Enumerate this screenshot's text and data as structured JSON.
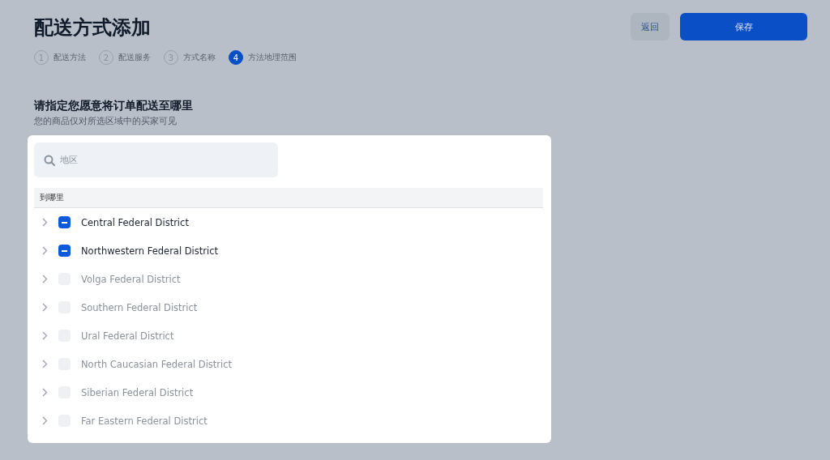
{
  "title": "配送方式添加",
  "steps": [
    {
      "number": "1",
      "label": "配送方法",
      "selected": false
    },
    {
      "number": "2",
      "label": "配送服务",
      "selected": false
    },
    {
      "number": "3",
      "label": "方式名称",
      "selected": false
    },
    {
      "number": "4",
      "label": "方法地理范围",
      "selected": true
    }
  ],
  "buttons": {
    "back": "返回",
    "save": "保存"
  },
  "section": {
    "heading": "请指定您愿意将订单配送至哪里",
    "subtitle": "您的商品仅对所选区域中的买家可见"
  },
  "search": {
    "placeholder": "地区"
  },
  "table": {
    "column": "到哪里",
    "rows": [
      {
        "name": "Central Federal District",
        "indeterminate": true
      },
      {
        "name": "Northwestern Federal District",
        "indeterminate": true
      },
      {
        "name": "Volga Federal District",
        "indeterminate": false
      },
      {
        "name": "Southern Federal District",
        "indeterminate": false
      },
      {
        "name": "Ural Federal District",
        "indeterminate": false
      },
      {
        "name": "North Caucasian Federal District",
        "indeterminate": false
      },
      {
        "name": "Siberian Federal District",
        "indeterminate": false
      },
      {
        "name": "Far Eastern Federal District",
        "indeterminate": false
      }
    ]
  }
}
